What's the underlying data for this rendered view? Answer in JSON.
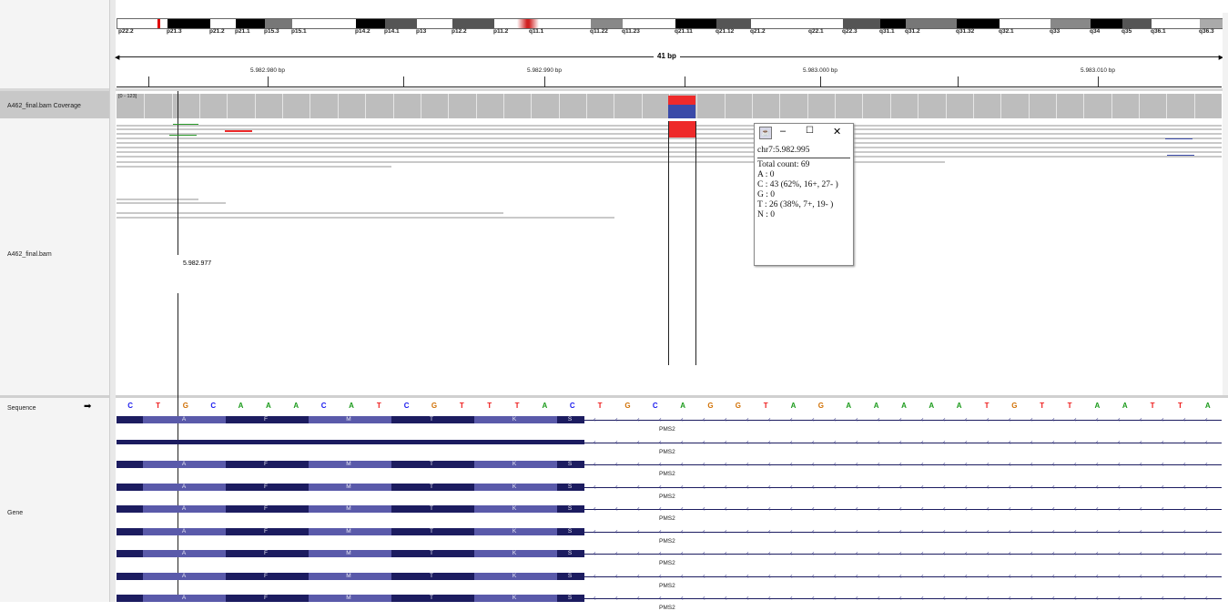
{
  "ideogram": {
    "bands": [
      "p22.2",
      "p21.3",
      "p21.2",
      "p21.1",
      "p15.3",
      "p15.1",
      "p14.2",
      "p14.1",
      "p13",
      "p12.2",
      "p11.2",
      "q11.1",
      "q11.22",
      "q11.23",
      "q21.11",
      "q21.12",
      "q21.2",
      "q22.1",
      "q22.3",
      "q31.1",
      "q31.2",
      "q31.32",
      "q32.1",
      "q33",
      "q34",
      "q35",
      "q36.1",
      "q36.3"
    ]
  },
  "ruler": {
    "span_label": "41 bp",
    "ticks": [
      "5.982.980 bp",
      "5.982.990 bp",
      "5.983.000 bp",
      "5.983.010 bp"
    ]
  },
  "tracks": {
    "coverage_label": "A462_final.bam Coverage",
    "coverage_range": "[0 - 123]",
    "alignment_label": "A462_final.bam",
    "sequence_label": "Sequence",
    "sequence_arrow": "➡",
    "gene_label": "Gene",
    "position_marker": "5.982.977"
  },
  "sequence": [
    "C",
    "T",
    "G",
    "C",
    "A",
    "A",
    "A",
    "C",
    "A",
    "T",
    "C",
    "G",
    "T",
    "T",
    "T",
    "A",
    "C",
    "T",
    "G",
    "C",
    "A",
    "G",
    "G",
    "T",
    "A",
    "G",
    "A",
    "A",
    "A",
    "A",
    "A",
    "T",
    "G",
    "T",
    "T",
    "A",
    "A",
    "T",
    "T",
    "A"
  ],
  "base_colors": {
    "A": "#1a9a1a",
    "C": "#1a1aee",
    "G": "#d17105",
    "T": "#ee1a1a"
  },
  "gene": {
    "name": "PMS2",
    "amino_acids": [
      "A",
      "F",
      "M",
      "T",
      "K",
      "S"
    ],
    "exon_color_light": "#5a5aaa",
    "exon_color_dark": "#1c1c60"
  },
  "popup": {
    "title": "chr7:5.982.995",
    "total": "Total count: 69",
    "lines": [
      "A : 0",
      "C : 43 (62%, 16+, 27- )",
      "G : 0",
      "T : 26 (38%, 7+, 19- )",
      "N : 0"
    ],
    "minimize": "–",
    "maximize": "☐",
    "close": "✕"
  },
  "colors": {
    "mismatch_red": "#ee2a2a",
    "mismatch_blue": "#3a4aa8",
    "coverage_gray": "#bdbdbd"
  }
}
